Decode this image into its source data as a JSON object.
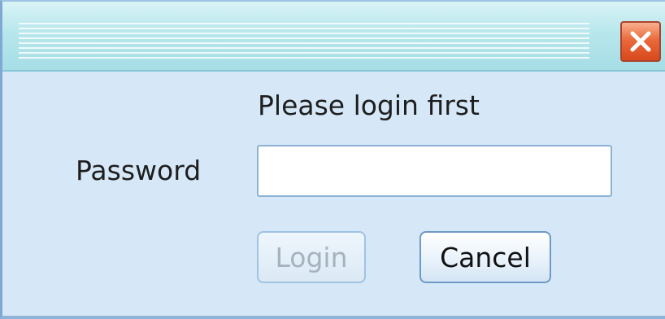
{
  "dialog": {
    "heading": "Please login first",
    "close_icon": "close-x-icon",
    "password": {
      "label": "Password",
      "value": "",
      "placeholder": ""
    },
    "buttons": {
      "login_label": "Login",
      "login_enabled": false,
      "cancel_label": "Cancel"
    }
  },
  "colors": {
    "background": "#d6e8f7",
    "titlebar": "#b7e7ec",
    "close_button": "#ea6a3c",
    "border": "#7fa9d4"
  }
}
